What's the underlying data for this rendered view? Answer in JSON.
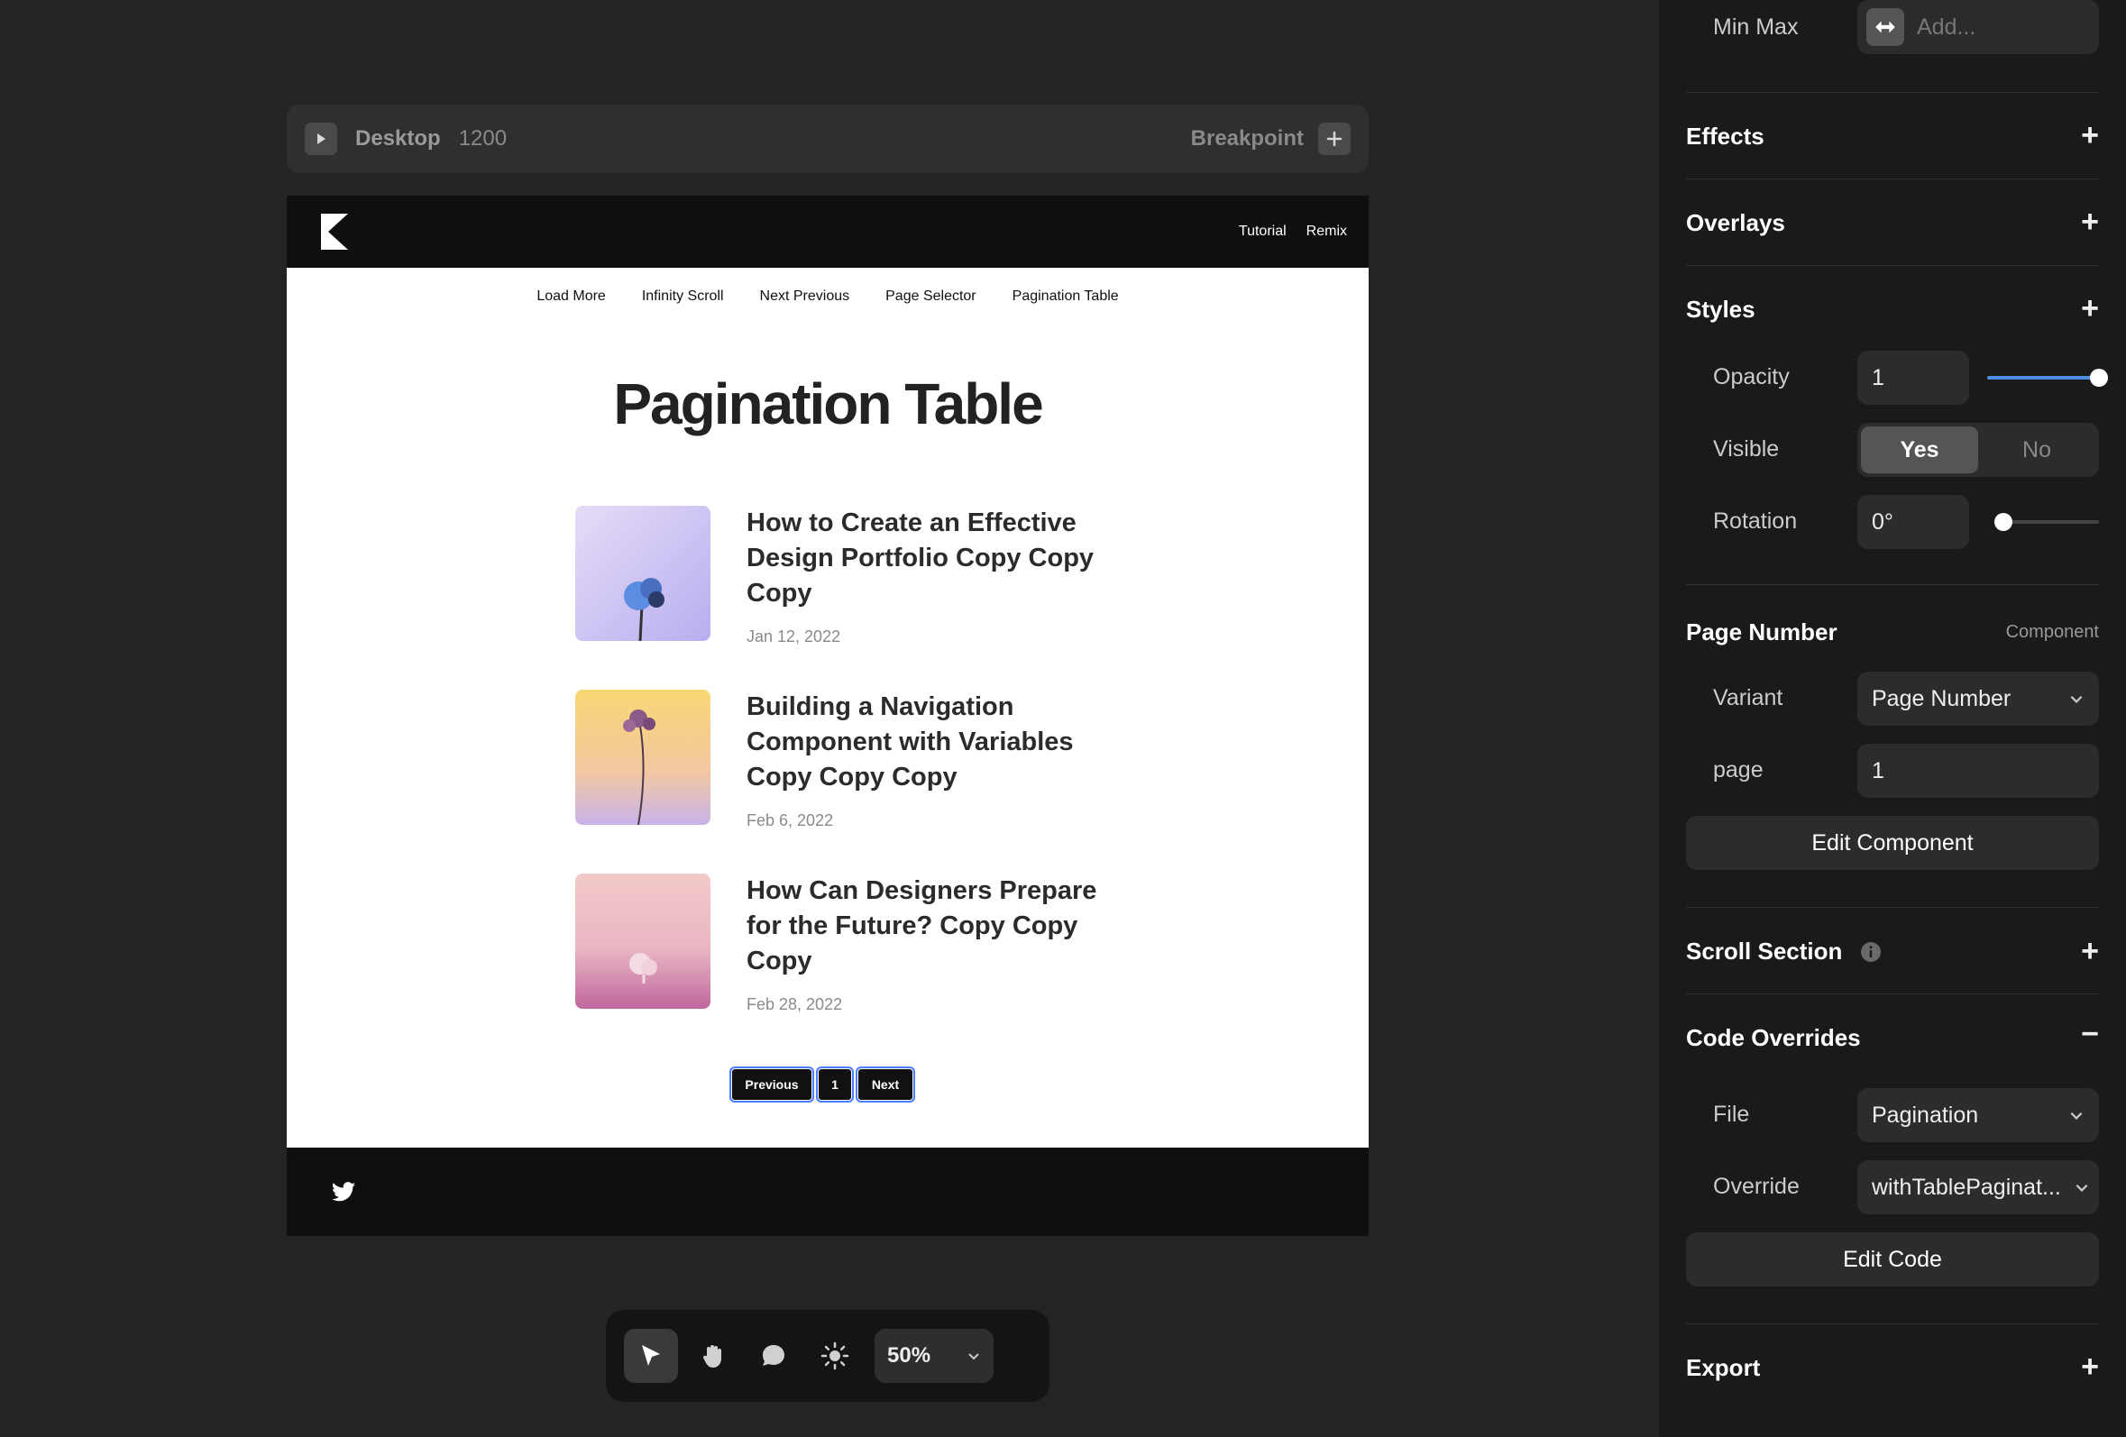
{
  "breakpoint_bar": {
    "device": "Desktop",
    "width": "1200",
    "breakpoint_label": "Breakpoint"
  },
  "site": {
    "header_links": [
      "Tutorial",
      "Remix"
    ],
    "subnav": [
      "Load More",
      "Infinity Scroll",
      "Next Previous",
      "Page Selector",
      "Pagination Table"
    ],
    "title": "Pagination Table",
    "posts": [
      {
        "title": "How to Create an Effective Design Portfolio Copy Copy Copy",
        "date": "Jan 12, 2022"
      },
      {
        "title": "Building a Navigation Component with Variables Copy Copy Copy",
        "date": "Feb 6, 2022"
      },
      {
        "title": "How Can Designers Prepare for the Future? Copy Copy Copy",
        "date": "Feb 28, 2022"
      }
    ],
    "pager": {
      "previous": "Previous",
      "page": "1",
      "next": "Next"
    }
  },
  "toolbar": {
    "zoom": "50%",
    "tools": [
      "pointer-icon",
      "hand-icon",
      "comment-icon",
      "sun-icon"
    ]
  },
  "panel": {
    "min_max": {
      "label": "Min Max",
      "placeholder": "Add..."
    },
    "effects": "Effects",
    "overlays": "Overlays",
    "styles": {
      "title": "Styles",
      "opacity_label": "Opacity",
      "opacity_value": "1",
      "opacity_level": 1.0,
      "visible_label": "Visible",
      "visible_yes": "Yes",
      "visible_no": "No",
      "rotation_label": "Rotation",
      "rotation_value": "0°",
      "rotation_level": 0.0
    },
    "page_number": {
      "title": "Page Number",
      "tag": "Component",
      "variant_label": "Variant",
      "variant_value": "Page Number",
      "page_label": "page",
      "page_value": "1",
      "edit_button": "Edit Component"
    },
    "scroll_section": "Scroll Section",
    "code_overrides": {
      "title": "Code Overrides",
      "file_label": "File",
      "file_value": "Pagination",
      "override_label": "Override",
      "override_value": "withTablePaginat...",
      "edit_button": "Edit Code"
    },
    "export": "Export",
    "accent_color": "#4a90e2"
  }
}
